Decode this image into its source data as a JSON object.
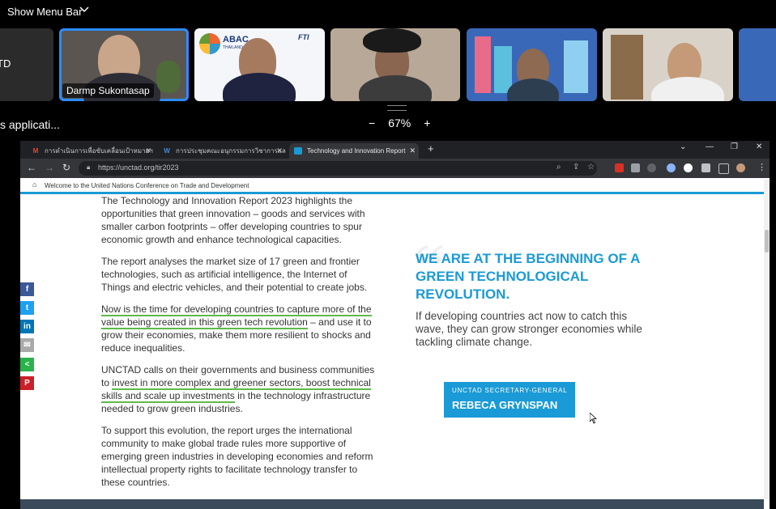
{
  "zoom_ui": {
    "menu_bar_label": "Show Menu Bar",
    "participants": [
      {
        "name": "TD"
      },
      {
        "name": "Darmp Sukontasap"
      },
      {
        "name": ""
      },
      {
        "name": ""
      },
      {
        "name": ""
      },
      {
        "name": ""
      }
    ],
    "tile_logos": {
      "abac": "ABAC",
      "abac_sub": "THAILAND 2023",
      "fti": "FTI"
    },
    "shared_app_label": "s applicati...",
    "zoom_minus": "−",
    "zoom_level": "67%",
    "zoom_plus": "+"
  },
  "browser": {
    "tabs": [
      {
        "label": "การดำเนินการเพื่อขับเคลื่อนเป้าหมายฯ",
        "favicon": "gmail-icon"
      },
      {
        "label": "การประชุมคณะอนุกรรมการวิชาการและ",
        "favicon": "web-icon"
      },
      {
        "label": "Technology and Innovation Report",
        "favicon": "unctad-icon"
      }
    ],
    "new_tab": "+",
    "url": "https://unctad.org/tir2023",
    "back": "←",
    "forward": "→",
    "reload": "↻"
  },
  "page": {
    "banner": "Welcome to the United Nations Conference on Trade and Development",
    "paragraphs": {
      "p1": "The Technology and Innovation Report 2023 highlights the opportunities that green innovation – goods and services with smaller carbon footprints – offer developing countries to spur economic growth and enhance technological capacities.",
      "p2": "The report analyses the market size of 17 green and frontier technologies, such as artificial intelligence, the Internet of Things and electric vehicles, and their potential to create jobs.",
      "p3_link": "Now is the time for developing countries to capture more of the value being created in this green tech revolution",
      "p3_rest": " – and use it to grow their economies, make them more resilient to shocks and reduce inequalities.",
      "p4_start": "UNCTAD calls on their governments and business communities to ",
      "p4_link": "invest in more complex and greener sectors, boost technical skills and scale up investments",
      "p4_rest": " in the technology infrastructure needed to grow green industries.",
      "p5": "To support this evolution, the report urges the international community to make global trade rules more supportive of emerging green industries in developing economies and reform intellectual property rights to facilitate technology transfer to these countries."
    },
    "quote": {
      "headline": "WE ARE AT THE BEGINNING OF A GREEN TECHNOLOGICAL REVOLUTION.",
      "body": "If developing countries act now to catch this wave, they can grow stronger economies while tackling climate change.",
      "role": "UNCTAD SECRETARY-GENERAL",
      "name": "REBECA GRYNSPAN"
    },
    "social": [
      {
        "icon": "facebook-icon",
        "glyph": "f",
        "color": "#3b5998"
      },
      {
        "icon": "twitter-icon",
        "glyph": "t",
        "color": "#1da1f2"
      },
      {
        "icon": "linkedin-icon",
        "glyph": "in",
        "color": "#0077b5"
      },
      {
        "icon": "email-icon",
        "glyph": "✉",
        "color": "#aaaaaa"
      },
      {
        "icon": "share-icon",
        "glyph": "<",
        "color": "#2ab34a"
      },
      {
        "icon": "pinterest-icon",
        "glyph": "P",
        "color": "#cb2027"
      }
    ]
  }
}
